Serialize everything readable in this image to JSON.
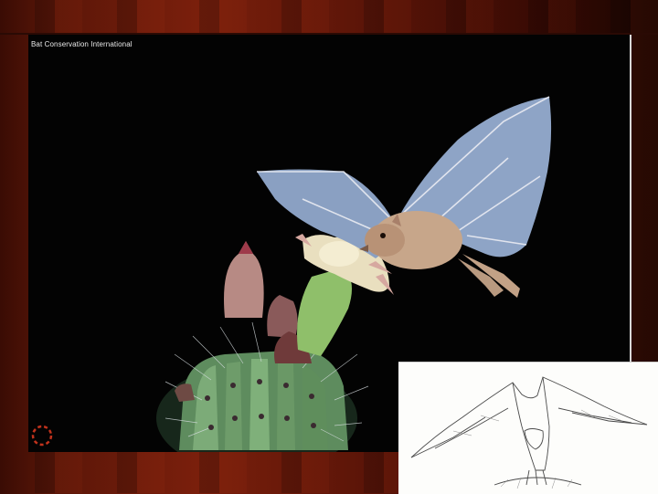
{
  "slide": {
    "photo_credit": "Bat Conservation International"
  },
  "colors": {
    "background_red": "#7a1f0c",
    "photo_bg": "#030303",
    "cactus_green": "#6f9a6a",
    "bat_wing": "#8fa6c8",
    "bat_body": "#c9a98c",
    "flower_cream": "#efe7c8"
  }
}
